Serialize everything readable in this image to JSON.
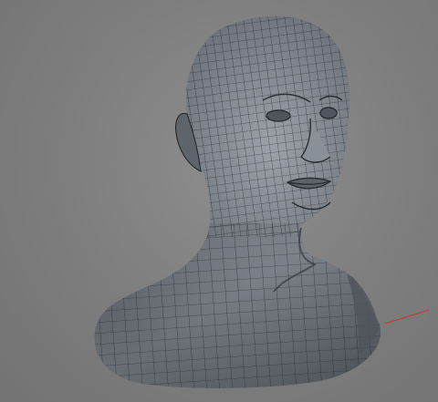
{
  "viewport": {
    "background_color": "#7f7f7f",
    "model": {
      "name_icon": "bust-mesh-icon",
      "surface_color": "#6f747b",
      "wire_color": "#1e2226"
    },
    "axis_indicator": {
      "icon": "x-axis-line-icon",
      "color": "#c0392b"
    }
  }
}
